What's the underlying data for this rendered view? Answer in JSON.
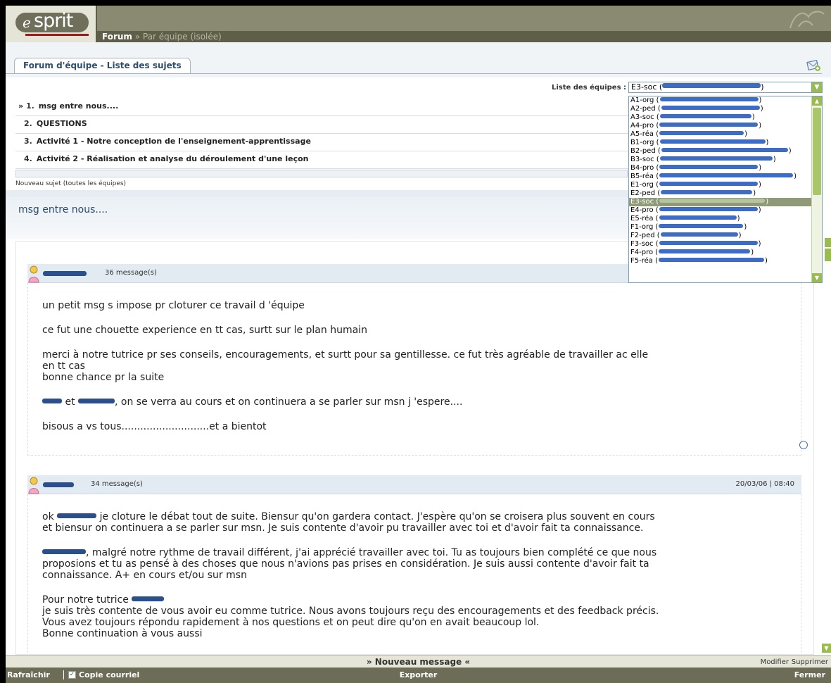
{
  "header": {
    "logo_text": "sprit",
    "logo_letter": "e",
    "breadcrumb_forum": "Forum",
    "breadcrumb_rest": " » Par équipe (isolée)"
  },
  "tab": {
    "label": "Forum d'équipe - Liste des sujets"
  },
  "teams": {
    "label": "Liste des équipes :",
    "selected": "E3-soc (",
    "selected_suffix": ")",
    "options": [
      {
        "code": "A1-org",
        "selected": false
      },
      {
        "code": "A2-ped",
        "selected": false
      },
      {
        "code": "A3-soc",
        "selected": false
      },
      {
        "code": "A4-pro",
        "selected": false
      },
      {
        "code": "A5-réa",
        "selected": false
      },
      {
        "code": "B1-org",
        "selected": false
      },
      {
        "code": "B2-ped",
        "selected": false
      },
      {
        "code": "B3-soc",
        "selected": false
      },
      {
        "code": "B4-pro",
        "selected": false
      },
      {
        "code": "B5-réa",
        "selected": false
      },
      {
        "code": "E1-org",
        "selected": false
      },
      {
        "code": "E2-ped",
        "selected": false
      },
      {
        "code": "E3-soc",
        "selected": true
      },
      {
        "code": "E4-pro",
        "selected": false
      },
      {
        "code": "E5-réa",
        "selected": false
      },
      {
        "code": "F1-org",
        "selected": false
      },
      {
        "code": "F2-ped",
        "selected": false
      },
      {
        "code": "F3-soc",
        "selected": false
      },
      {
        "code": "F4-pro",
        "selected": false
      },
      {
        "code": "F5-réa",
        "selected": false
      }
    ]
  },
  "topics": [
    {
      "num": "1.",
      "title": "msg entre nous...."
    },
    {
      "num": "2.",
      "title": "QUESTIONS"
    },
    {
      "num": "3.",
      "title": "Activité 1 - Notre conception de l'enseignement-apprentissage"
    },
    {
      "num": "4.",
      "title": "Activité 2 - Réalisation et analyse du déroulement d'une leçon"
    }
  ],
  "topic_marker": "»",
  "new_topic": "Nouveau sujet (toutes les équipes)",
  "subject_title": "msg entre nous....",
  "messages": [
    {
      "count": "36 message(s)",
      "date": "",
      "p1": "un petit msg s impose pr cloturer ce travail d 'équipe",
      "p2": "ce fut une chouette experience en tt cas, surtt sur le plan humain",
      "p3a": "merci à notre tutrice pr ses conseils, encouragements, et surtt pour sa gentillesse. ce fut très agréable de travailler ac elle",
      "p3b": "en tt cas",
      "p3c": "bonne chance pr la suite",
      "p4a": " et ",
      "p4b": ", on se verra au cours et on continuera a se parler sur msn j 'espere....",
      "p5": "bisous a vs tous............................et a bientot"
    },
    {
      "count": "34 message(s)",
      "date": "20/03/06 | 08:40",
      "p1a": "ok ",
      "p1b": " je cloture le débat tout de suite. Biensur qu'on gardera contact. J'espère qu'on se croisera plus souvent en cours",
      "p1c": "et biensur on continuera a se parler sur msn. Je suis contente d'avoir pu travailler avec toi et d'avoir fait ta connaissance.",
      "p2a": ", malgré notre rythme de travail différent, j'ai apprécié travailler avec toi. Tu as toujours bien complété ce que nous",
      "p2b": "proposions et tu as pensé à des choses que nous n'avions pas prises en considération. Je suis aussi contente d'avoir fait ta",
      "p2c": "connaissance. A+ en cours et/ou sur msn",
      "p3a": "Pour notre tutrice ",
      "p3b": "je suis très contente de vous avoir eu comme tutrice. Nous avons toujours reçu des encouragements et des feedback précis.",
      "p3c": "Vous avez toujours répondu rapidement à nos questions et on peut dire qu'on en avait beaucoup lol.",
      "p3d": "Bonne continuation à vous aussi"
    }
  ],
  "footer": {
    "new_message": "» Nouveau message «",
    "modify": "Modifier",
    "delete": "Supprimer",
    "refresh": "Rafraîchir",
    "copy_mail": "Copie courriel",
    "copy_checked": "✓",
    "export": "Exporter",
    "close": "Fermer"
  },
  "colors": {
    "header_bg": "#8a8a73",
    "accent_green": "#9abb52",
    "title_blue": "#2e4d6a",
    "redaction_blue": "#2a4f8c"
  }
}
